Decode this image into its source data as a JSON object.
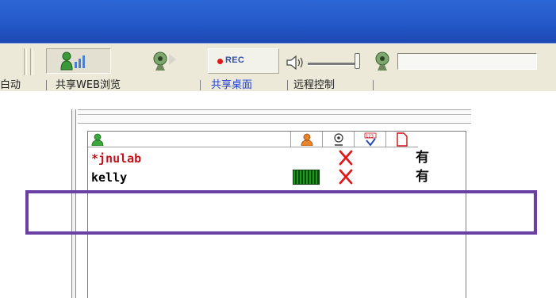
{
  "toolbar": {
    "rec_label": "REC",
    "tabs": [
      {
        "label": "白动"
      },
      {
        "label": "共享WEB浏览"
      },
      {
        "label": "共享桌面"
      },
      {
        "label": "远程控制"
      }
    ],
    "colors": {
      "tab_active": "#1f3fd0",
      "rec": "#e01818",
      "titlebar": "#2458c8"
    },
    "icons": [
      "speaker-level-icon",
      "webcam-icon",
      "record-icon",
      "volume-speaker-icon",
      "microphone-icon"
    ]
  },
  "userlist": {
    "columns": [
      {
        "icon": "user-icon"
      },
      {
        "icon": "audio-user-icon"
      },
      {
        "icon": "webcam-icon"
      },
      {
        "icon": "question-icon"
      },
      {
        "icon": "document-icon"
      }
    ],
    "rows": [
      {
        "name": "*jnulab",
        "name_color": "#c0141c",
        "has_audio_level": false,
        "video": "X",
        "file": "有"
      },
      {
        "name": "kelly",
        "name_color": "#000000",
        "has_audio_level": true,
        "video": "X",
        "file": "有"
      }
    ],
    "highlight_color": "#6b3fa3"
  }
}
